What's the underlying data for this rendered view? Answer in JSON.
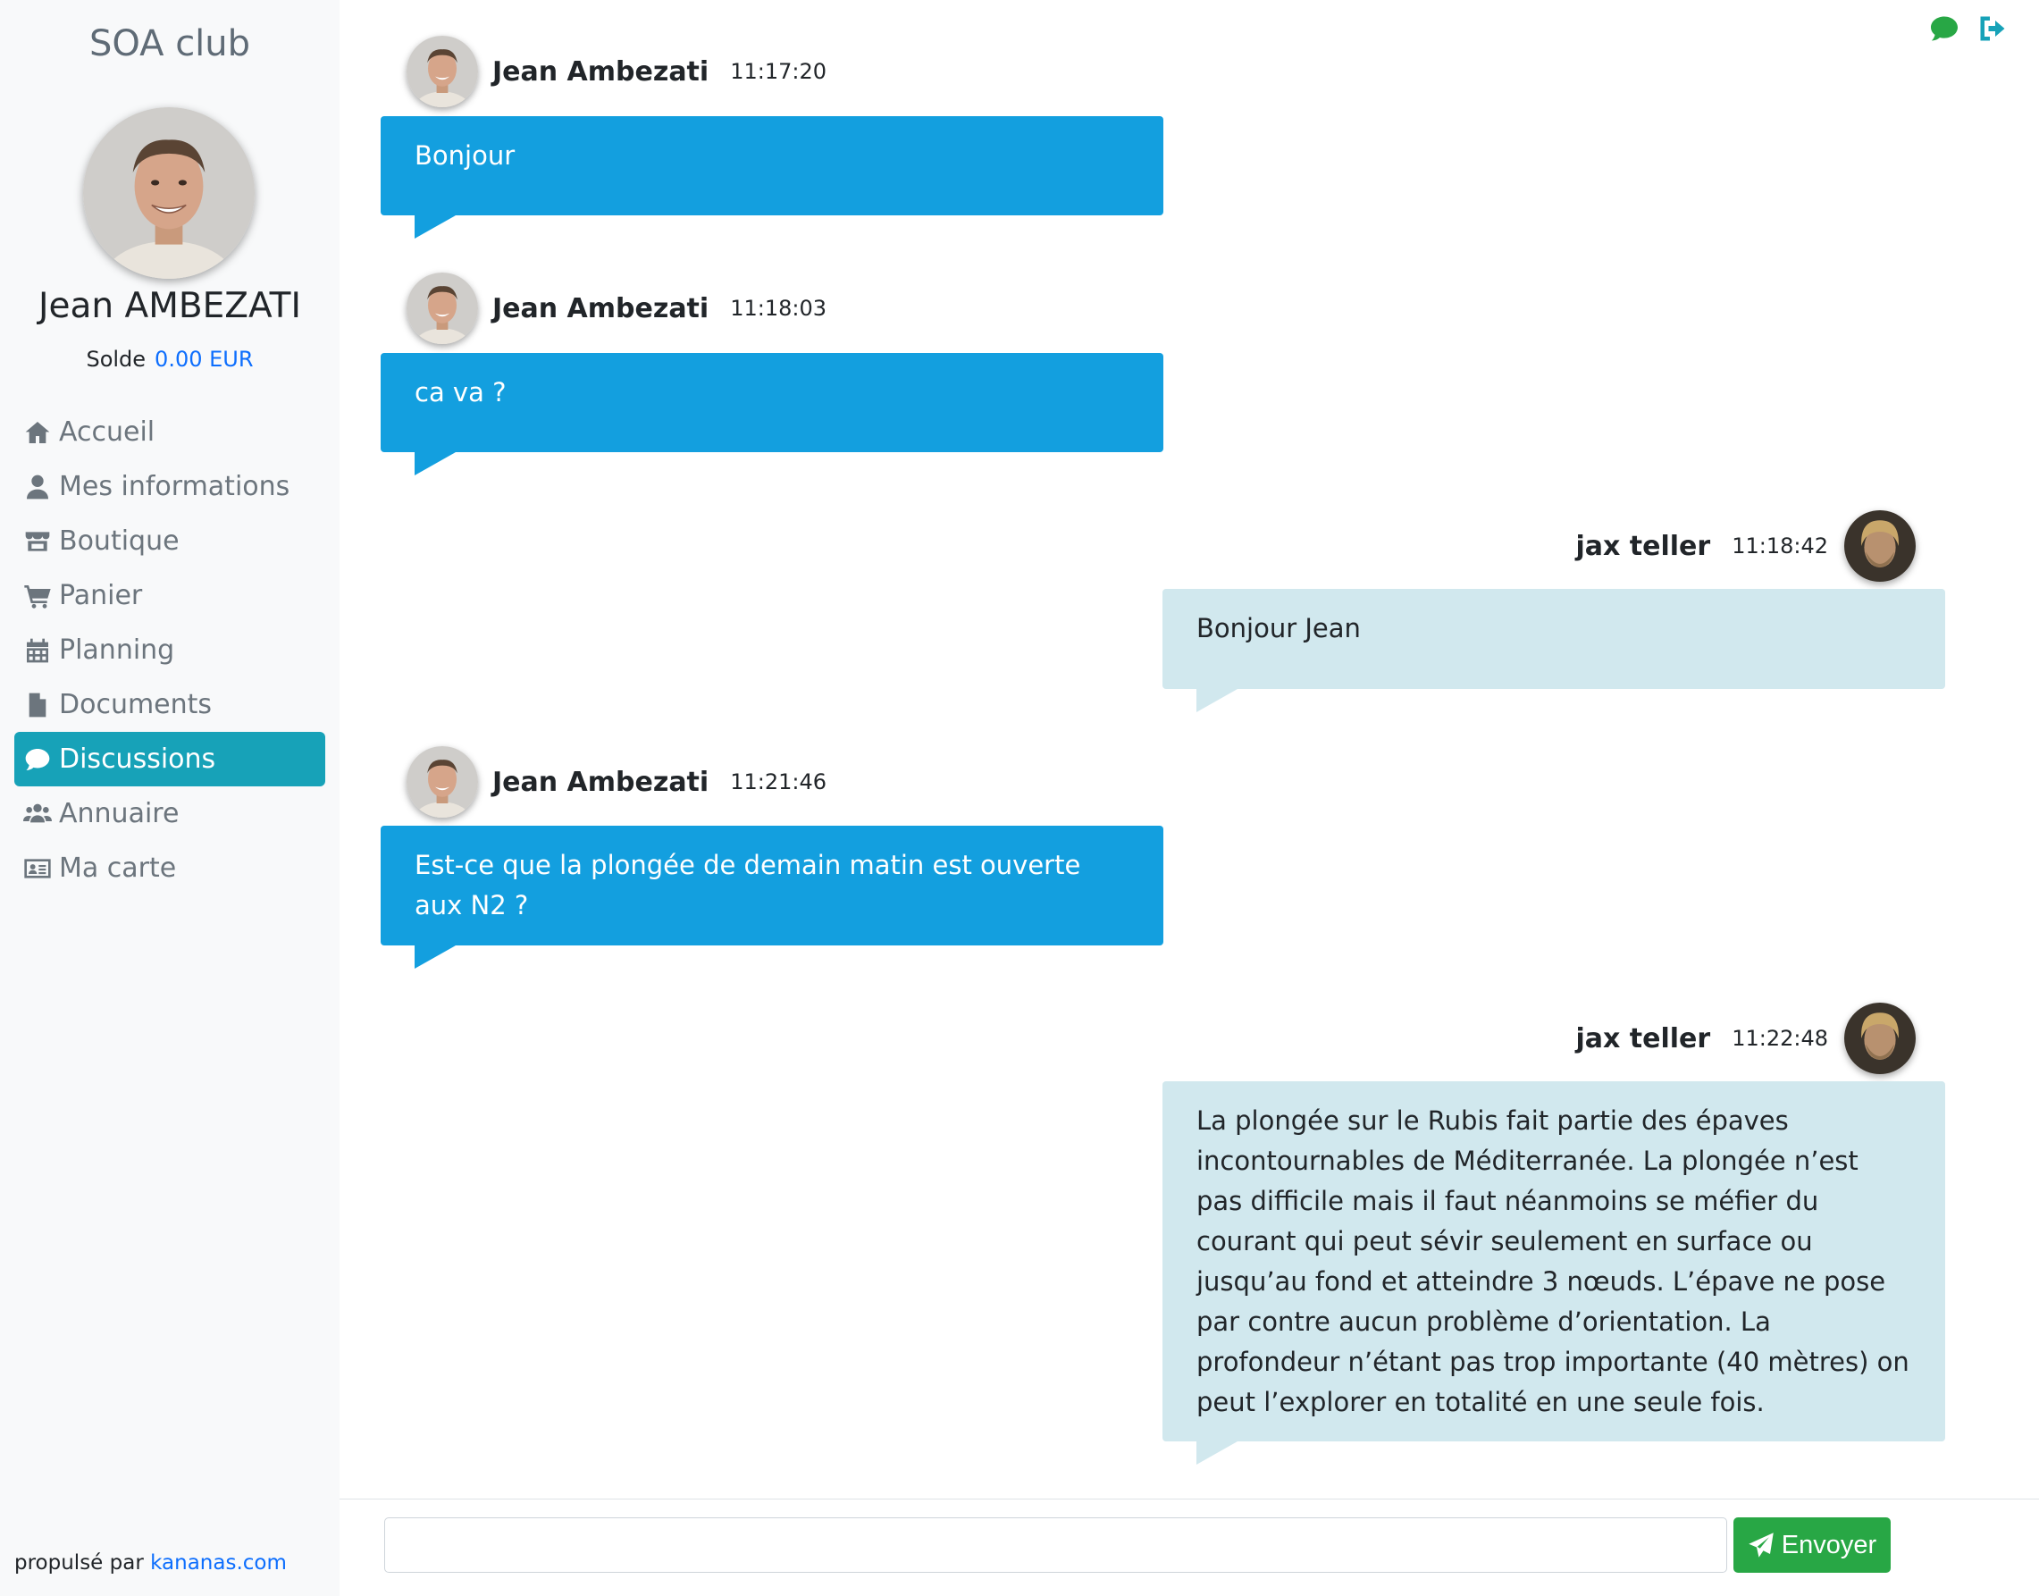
{
  "sidebar": {
    "brand": "SOA club",
    "profile_name": "Jean AMBEZATI",
    "balance_label": "Solde",
    "balance_value": "0.00 EUR",
    "nav": [
      {
        "label": "Accueil",
        "icon": "home-icon"
      },
      {
        "label": "Mes informations",
        "icon": "user-icon"
      },
      {
        "label": "Boutique",
        "icon": "store-icon"
      },
      {
        "label": "Panier",
        "icon": "cart-icon"
      },
      {
        "label": "Planning",
        "icon": "calendar-icon"
      },
      {
        "label": "Documents",
        "icon": "file-icon"
      },
      {
        "label": "Discussions",
        "icon": "comment-icon",
        "active": true
      },
      {
        "label": "Annuaire",
        "icon": "users-icon"
      },
      {
        "label": "Ma carte",
        "icon": "id-card-icon"
      }
    ],
    "footer_prefix": "propulsé par",
    "footer_link": "kananas.com"
  },
  "top_icons": [
    "chat-icon",
    "sign-out-icon"
  ],
  "messages": [
    {
      "author": "Jean Ambezati",
      "time": "11:17:20",
      "side": "left",
      "text": "Bonjour"
    },
    {
      "author": "Jean Ambezati",
      "time": "11:18:03",
      "side": "left",
      "text": "ca va ?"
    },
    {
      "author": "jax teller",
      "time": "11:18:42",
      "side": "right",
      "text": "Bonjour Jean"
    },
    {
      "author": "Jean Ambezati",
      "time": "11:21:46",
      "side": "left",
      "text": "Est-ce que la plongée de demain matin est ouverte aux N2 ?"
    },
    {
      "author": "jax teller",
      "time": "11:22:48",
      "side": "right",
      "text": "La plongée sur le Rubis fait partie des épaves incontournables de Méditerranée. La plongée n’est pas difficile mais il faut néanmoins se méfier du courant qui peut sévir seulement en surface ou jusqu’au fond et atteindre 3 nœuds. L’épave ne pose par contre aucun problème d’orientation. La profondeur n’étant pas trop importante (40 mètres) on peut l’explorer en totalité en une seule fois."
    }
  ],
  "composer": {
    "input_value": "",
    "send_label": "Envoyer"
  },
  "colors": {
    "active_nav": "#17a2b8",
    "my_bubble": "#139fdf",
    "their_bubble": "#d1e8ee",
    "send_button": "#28a745",
    "link": "#0d6efd"
  }
}
